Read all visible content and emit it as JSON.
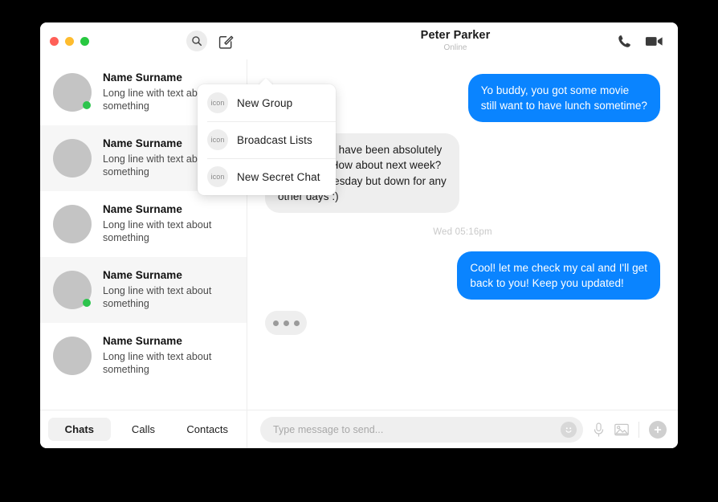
{
  "window": {
    "traffic_lights": [
      {
        "name": "close",
        "color": "#ff5f57"
      },
      {
        "name": "minimize",
        "color": "#febc2e"
      },
      {
        "name": "maximize",
        "color": "#28c840"
      }
    ]
  },
  "sidebar": {
    "actions": [
      {
        "icon": "search-icon",
        "label": "Search"
      },
      {
        "icon": "compose-icon",
        "label": "New Message"
      }
    ],
    "chats": [
      {
        "name": "Name Surname",
        "preview": "Long line with text about something",
        "online": true,
        "selected": false
      },
      {
        "name": "Name Surname",
        "preview": "Long line with text about something",
        "online": false,
        "selected": true
      },
      {
        "name": "Name Surname",
        "preview": "Long line with text about something",
        "online": false,
        "selected": false
      },
      {
        "name": "Name Surname",
        "preview": "Long line with text about something",
        "online": true,
        "selected": true
      },
      {
        "name": "Name Surname",
        "preview": "Long line with text about something",
        "online": false,
        "selected": false
      }
    ],
    "tabs": [
      {
        "label": "Chats",
        "active": true
      },
      {
        "label": "Calls",
        "active": false
      },
      {
        "label": "Contacts",
        "active": false
      }
    ]
  },
  "dropdown": {
    "items": [
      {
        "icon_label": "icon",
        "label": "New Group"
      },
      {
        "icon_label": "icon",
        "label": "Broadcast Lists"
      },
      {
        "icon_label": "icon",
        "label": "New Secret Chat"
      }
    ]
  },
  "chat": {
    "peer_name": "Peter Parker",
    "peer_status": "Online",
    "call_actions": [
      {
        "icon": "phone-icon",
        "label": "Voice call"
      },
      {
        "icon": "video-icon",
        "label": "Video call"
      }
    ],
    "messages": [
      {
        "direction": "out",
        "text": "Yo buddy, you got some movie\nstill want to have lunch sometime?"
      },
      {
        "direction": "in",
        "text": "Hey Peter! I have been absolutely\nswamped. How about next week?\nCan't do Tuesday but down for any\nother days :)"
      },
      {
        "direction": "timestamp",
        "text": "Wed 05:16pm"
      },
      {
        "direction": "out",
        "text": "Cool! let me check my cal and I'll get\nback to you! Keep you updated!"
      },
      {
        "direction": "typing",
        "text": ""
      }
    ]
  },
  "composer": {
    "placeholder": "Type message to send...",
    "value": "",
    "emoji_icon": "smiley-icon",
    "actions": [
      {
        "icon": "microphone-icon",
        "label": "Record voice"
      },
      {
        "icon": "image-icon",
        "label": "Attach image"
      },
      {
        "icon": "plus-icon",
        "label": "More options"
      }
    ]
  },
  "colors": {
    "accent_blue": "#0a84ff",
    "incoming_bubble": "#eeeeee",
    "online_green": "#2dc44d",
    "selected_row": "#f6f6f6"
  }
}
